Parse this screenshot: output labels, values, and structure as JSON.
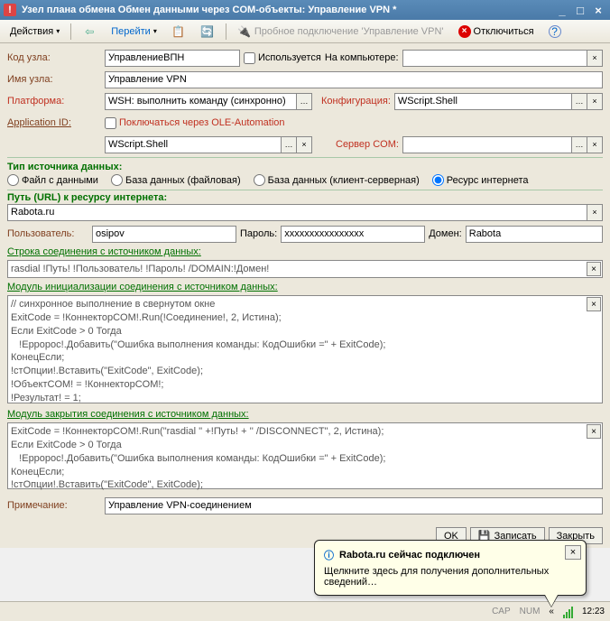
{
  "window": {
    "title": "Узел плана обмена Обмен данными через COM-объекты: Управление VPN *"
  },
  "toolbar": {
    "actions": "Действия",
    "goto": "Перейти",
    "test_conn": "Пробное подключение 'Управление VPN'",
    "disconnect": "Отключиться"
  },
  "form": {
    "code_label": "Код узла:",
    "code_value": "УправлениеВПН",
    "used_label": "Используется",
    "computer_label": "На компьютере:",
    "name_label": "Имя узла:",
    "name_value": "Управление VPN",
    "platform_label": "Платформа:",
    "platform_value": "WSH: выполнить команду (синхронно)",
    "config_label": "Конфигурация:",
    "config_value": "WScript.Shell",
    "appid_label": "Application ID:",
    "ole_label": "Поключаться через OLE-Automation",
    "appid_value": "WScript.Shell",
    "comserver_label": "Сервер COM:",
    "srctype_label": "Тип источника данных:",
    "radio1": "Файл с данными",
    "radio2": "База данных (файловая)",
    "radio3": "База данных (клиент-серверная)",
    "radio4": "Ресурс интернета",
    "url_label": "Путь (URL) к ресурсу интернета:",
    "url_value": "Rabota.ru",
    "user_label": "Пользователь:",
    "user_value": "osipov",
    "pass_label": "Пароль:",
    "pass_value": "xxxxxxxxxxxxxxxx",
    "domain_label": "Домен:",
    "domain_value": "Rabota",
    "connstr_label": "Строка соединения с источником данных:",
    "connstr_value": "rasdial !Путь! !Пользователь! !Пароль! /DOMAIN:!Домен!",
    "init_label": "Модуль инициализации соединения с источником данных:",
    "init_value": "// синхронное выполнение в свернутом окне\nExitCode = !КоннекторCOM!.Run(!Соединение!, 2, Истина);\nЕсли ExitCode > 0 Тогда\n   !Ерророс!.Добавить(\"Ошибка выполнения команды: КодОшибки =\" + ExitCode);\nКонецЕсли;\n!стОпции!.Вставить(\"ExitCode\", ExitCode);\n!ОбъектCOM! = !КоннекторCOM!;\n!Результат! = 1;",
    "close_label": "Модуль закрытия соединения с источником данных:",
    "close_value": "ExitCode = !КоннекторCOM!.Run(\"rasdial '' +!Путь! + '' /DISCONNECT\", 2, Истина);\nЕсли ExitCode > 0 Тогда\n   !Ерророс!.Добавить(\"Ошибка выполнения команды: КодОшибки =\" + ExitCode);\nКонецЕсли;\n!стОпции!.Вставить(\"ExitCode\", ExitCode);",
    "note_label": "Примечание:",
    "note_value": "Управление VPN-соединением",
    "ok_btn": "OK",
    "save_btn": "Записать",
    "close_btn": "Закрыть"
  },
  "balloon": {
    "title": "Rabota.ru сейчас подключен",
    "body": "Щелкните здесь для получения дополнительных сведений…"
  },
  "statusbar": {
    "cap": "CAP",
    "num": "NUM",
    "time": "12:23"
  }
}
